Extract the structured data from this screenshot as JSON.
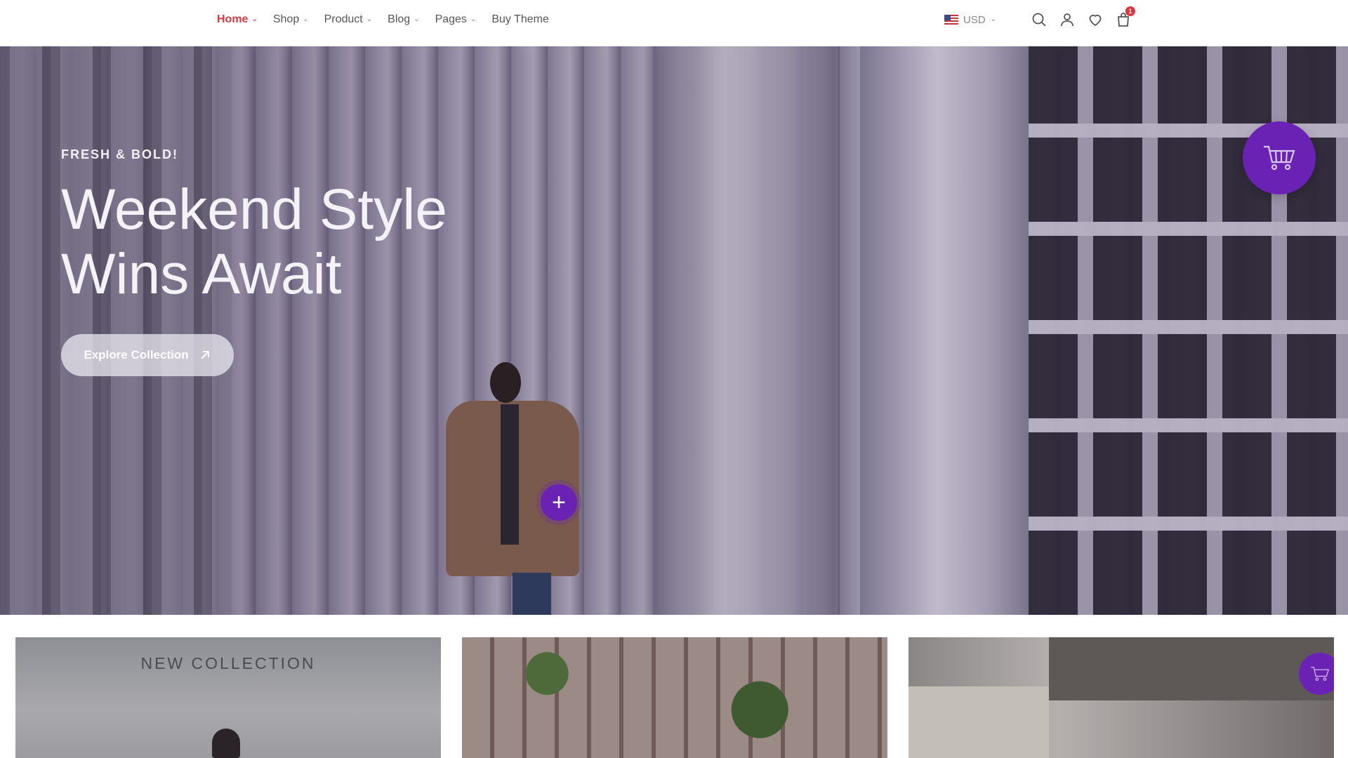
{
  "nav": {
    "items": [
      {
        "label": "Home",
        "active": true,
        "has_dropdown": true
      },
      {
        "label": "Shop",
        "active": false,
        "has_dropdown": true
      },
      {
        "label": "Product",
        "active": false,
        "has_dropdown": true
      },
      {
        "label": "Blog",
        "active": false,
        "has_dropdown": true
      },
      {
        "label": "Pages",
        "active": false,
        "has_dropdown": true
      },
      {
        "label": "Buy Theme",
        "active": false,
        "has_dropdown": false
      }
    ]
  },
  "header": {
    "currency": "USD",
    "currency_flag": "us-flag-icon",
    "icons": [
      "search-icon",
      "user-icon",
      "heart-icon",
      "bag-icon"
    ],
    "cart_count": "1"
  },
  "hero": {
    "eyebrow": "FRESH & BOLD!",
    "title_line1": "Weekend Style",
    "title_line2": "Wins Await",
    "cta_label": "Explore Collection",
    "hotspot_symbol": "+"
  },
  "cards": [
    {
      "label": "NEW COLLECTION"
    },
    {
      "label": ""
    },
    {
      "label": ""
    }
  ],
  "colors": {
    "accent": "#e0353e",
    "brand_purple": "#6a22b5",
    "nav_text": "#555555"
  }
}
